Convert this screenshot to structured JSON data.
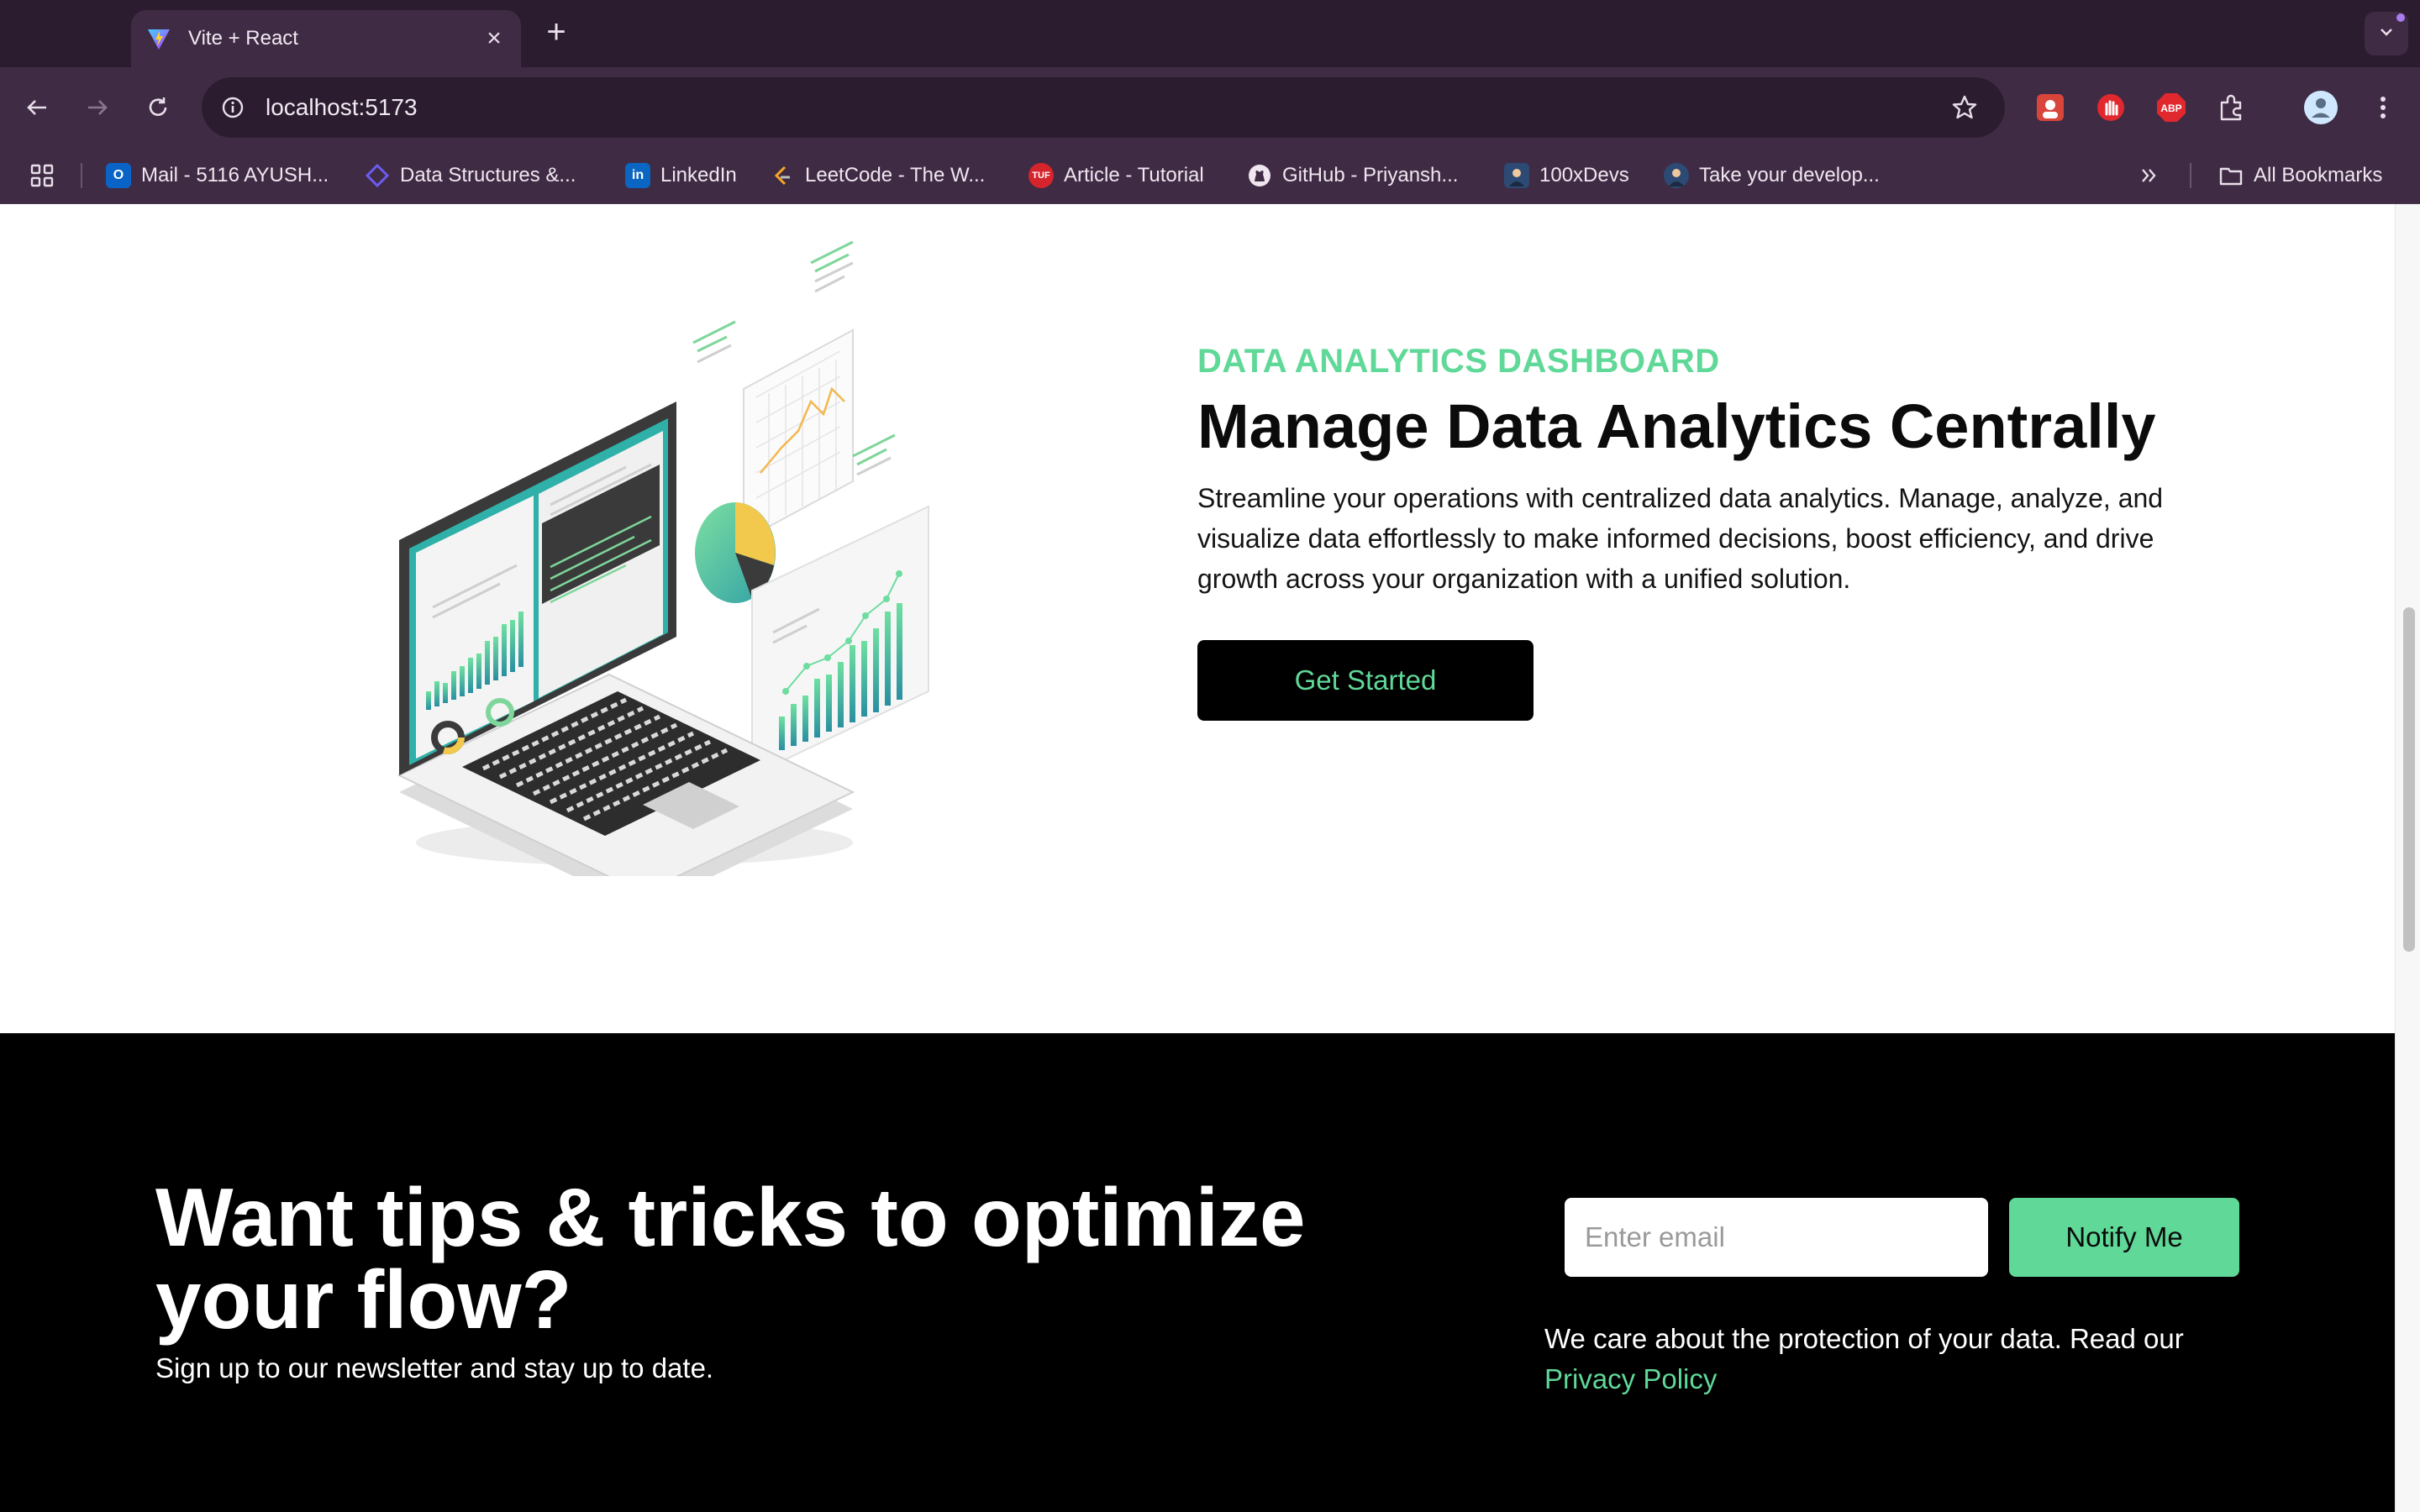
{
  "browser": {
    "tab_title": "Vite + React",
    "url": "localhost:5173",
    "bookmarks": [
      {
        "label": "Mail - 5116 AYUSH...",
        "icon": "outlook-icon"
      },
      {
        "label": "Data Structures &...",
        "icon": "dsa-icon"
      },
      {
        "label": "LinkedIn",
        "icon": "linkedin-icon"
      },
      {
        "label": "LeetCode - The W...",
        "icon": "leetcode-icon"
      },
      {
        "label": "Article - Tutorial",
        "icon": "tuf-icon"
      },
      {
        "label": "GitHub - Priyansh...",
        "icon": "github-icon"
      },
      {
        "label": "100xDevs",
        "icon": "avatar-icon"
      },
      {
        "label": "Take your develop...",
        "icon": "avatar-icon"
      }
    ],
    "all_bookmarks": "All Bookmarks",
    "extensions": [
      "profile-icon",
      "block-icon",
      "adblock-icon",
      "puzzle-icon"
    ],
    "abp_label": "ABP"
  },
  "hero": {
    "eyebrow": "DATA ANALYTICS DASHBOARD",
    "title": "Manage Data Analytics Centrally",
    "description": "Streamline your operations with centralized data analytics. Manage, analyze, and visualize data effortlessly to make informed decisions, boost efficiency, and drive growth across your organization with a unified solution.",
    "cta": "Get Started"
  },
  "newsletter": {
    "title": "Want tips & tricks to optimize your flow?",
    "subtitle": "Sign up to our newsletter and stay up to date.",
    "email_placeholder": "Enter email",
    "button": "Notify Me",
    "privacy_text": "We care about the protection of your data. Read our",
    "privacy_link": "Privacy Policy"
  },
  "colors": {
    "accent": "#5fd898",
    "chrome_dark": "#2b1d2f",
    "chrome": "#402b44"
  }
}
